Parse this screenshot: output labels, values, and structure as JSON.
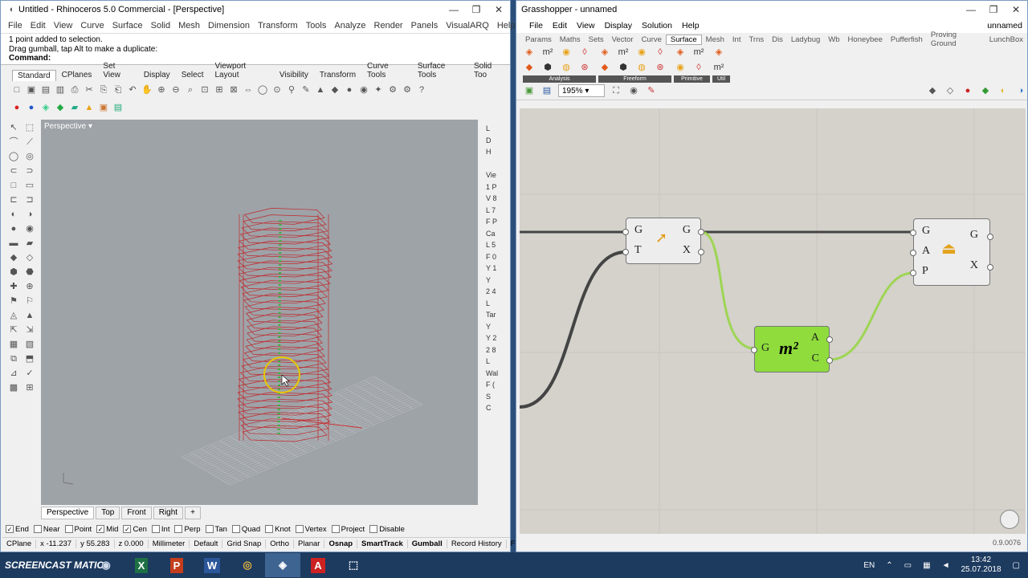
{
  "rhino": {
    "title": "Untitled - Rhinoceros 5.0 Commercial - [Perspective]",
    "menu": [
      "File",
      "Edit",
      "View",
      "Curve",
      "Surface",
      "Solid",
      "Mesh",
      "Dimension",
      "Transform",
      "Tools",
      "Analyze",
      "Render",
      "Panels",
      "VisualARQ",
      "Help"
    ],
    "cmd_lines": [
      "1 point added to selection.",
      "Drag gumball, tap Alt to make a duplicate:"
    ],
    "cmd_prompt": "Command:",
    "tabs": [
      "Standard",
      "CPlanes",
      "Set View",
      "Display",
      "Select",
      "Viewport Layout",
      "Visibility",
      "Transform",
      "Curve Tools",
      "Surface Tools",
      "Solid Too"
    ],
    "viewport_label": "Perspective",
    "right_panel": [
      "L",
      "D",
      "H",
      "",
      "Vie",
      "1 P",
      "V 8",
      "L 7",
      "F P",
      "Ca",
      "L 5",
      "F 0",
      "Y 1",
      "Y",
      "2 4",
      "L",
      "Tar",
      "Y",
      "Y 2",
      "2 8",
      "L",
      "Wal",
      "F (",
      "S",
      "C"
    ],
    "view_tabs": [
      "Perspective",
      "Top",
      "Front",
      "Right"
    ],
    "osnaps": [
      {
        "label": "End",
        "checked": true
      },
      {
        "label": "Near",
        "checked": false
      },
      {
        "label": "Point",
        "checked": false
      },
      {
        "label": "Mid",
        "checked": true
      },
      {
        "label": "Cen",
        "checked": true
      },
      {
        "label": "Int",
        "checked": false
      },
      {
        "label": "Perp",
        "checked": false
      },
      {
        "label": "Tan",
        "checked": false
      },
      {
        "label": "Quad",
        "checked": false
      },
      {
        "label": "Knot",
        "checked": false
      },
      {
        "label": "Vertex",
        "checked": false
      },
      {
        "label": "Project",
        "checked": false
      },
      {
        "label": "Disable",
        "checked": false
      }
    ],
    "status": [
      "CPlane",
      "x -11.237",
      "y 55.283",
      "z 0.000",
      "Millimeter",
      "Default",
      "Grid Snap",
      "Ortho",
      "Planar",
      "Osnap",
      "SmartTrack",
      "Gumball",
      "Record History",
      "Filter"
    ]
  },
  "gh": {
    "title": "Grasshopper - unnamed",
    "doc_name": "unnamed",
    "menu": [
      "File",
      "Edit",
      "View",
      "Display",
      "Solution",
      "Help"
    ],
    "tabs": [
      "Params",
      "Maths",
      "Sets",
      "Vector",
      "Curve",
      "Surface",
      "Mesh",
      "Int",
      "Trns",
      "Dis",
      "Ladybug",
      "Wb",
      "Honeybee",
      "Pufferfish",
      "Proving Ground",
      "LunchBox"
    ],
    "active_tab": "Surface",
    "ribbon_groups": [
      "Analysis",
      "Freeform",
      "Primitive",
      "Util"
    ],
    "zoom": "195%",
    "version": "0.9.0076",
    "components": [
      {
        "inputs": [
          "G",
          "T"
        ],
        "outputs": [
          "G",
          "X"
        ]
      },
      {
        "inputs": [
          "G",
          "A",
          "P"
        ],
        "outputs": [
          "G",
          "X"
        ]
      },
      {
        "inputs": [
          "G"
        ],
        "outputs": [
          "A",
          "C"
        ],
        "icon_text": "m²"
      }
    ]
  },
  "taskbar": {
    "watermark": "SCREENCAST",
    "watermark2": "MATIC",
    "lang": "EN",
    "time": "13:42",
    "date": "25.07.2018"
  }
}
